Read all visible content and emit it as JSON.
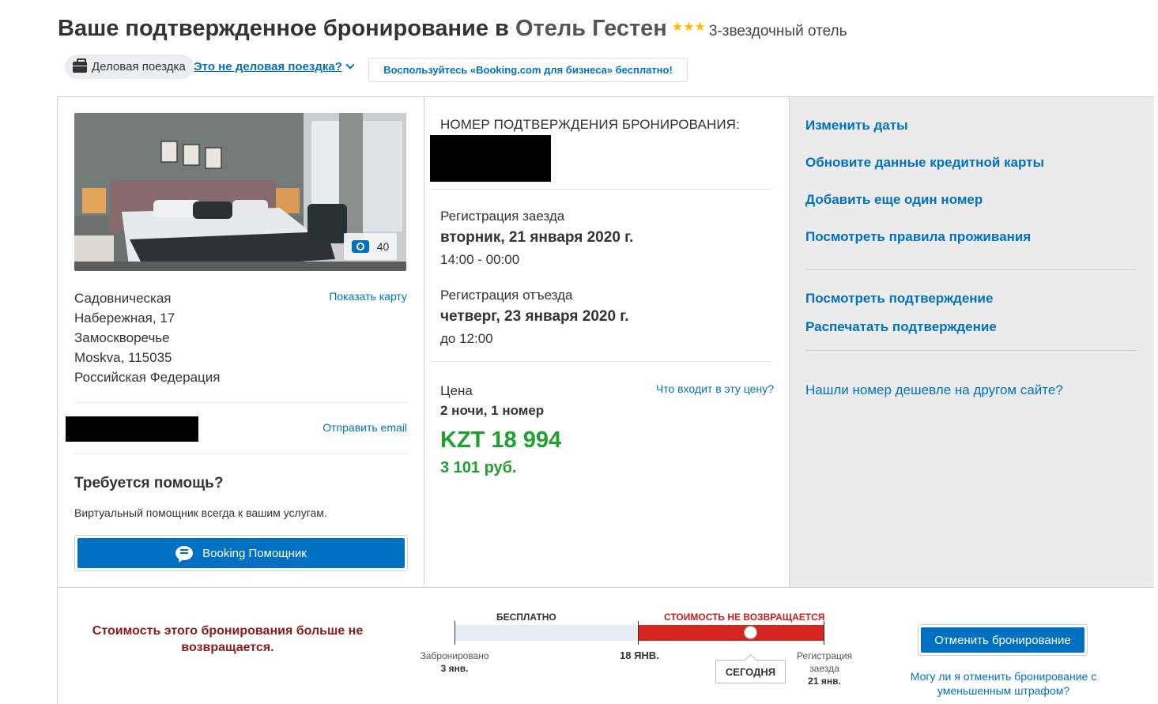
{
  "header": {
    "title_prefix": "Ваше подтвержденное бронирование в ",
    "hotel_name": "Отель Гестен",
    "stars": "★★★",
    "stars_label": "3-звездочный отель"
  },
  "trip": {
    "type_label": "Деловая поездка",
    "not_business_link": "Это не деловая поездка?",
    "business_promo": "Воспользуйтесь «Booking.com для бизнеса» бесплатно!"
  },
  "hotel": {
    "photo_count": "40",
    "address_lines": [
      "Садовническая",
      "Набережная, 17",
      "Замоскворечье",
      "Moskva, 115035",
      "Российская Федерация"
    ],
    "show_map": "Показать карту",
    "send_email": "Отправить email",
    "help_title": "Требуется помощь?",
    "help_subtitle": "Виртуальный помощник всегда к вашим услугам.",
    "assistant_button": "Booking Помощник"
  },
  "booking": {
    "confirmation_label": "НОМЕР ПОДТВЕРЖДЕНИЯ БРОНИРОВАНИЯ:",
    "checkin_label": "Регистрация заезда",
    "checkin_date": "вторник, 21 января 2020 г.",
    "checkin_time": "14:00 - 00:00",
    "checkout_label": "Регистрация отъезда",
    "checkout_date": "четверг, 23 января 2020 г.",
    "checkout_time": "до 12:00",
    "price_label": "Цена",
    "price_included_link": "Что входит в эту цену?",
    "stay_summary": "2 ночи, 1 номер",
    "price_kzt": "KZT 18 994",
    "price_rub": "3 101 руб."
  },
  "actions": {
    "change_dates": "Изменить даты",
    "update_card": "Обновите данные кредитной карты",
    "add_room": "Добавить еще один номер",
    "house_rules": "Посмотреть правила проживания",
    "view_confirmation": "Посмотреть подтверждение",
    "print_confirmation": "Распечатать подтверждение",
    "found_cheaper": "Нашли номер дешевле на другом сайте?"
  },
  "cancellation": {
    "message": "Стоимость этого бронирования больше не возвращается.",
    "free_label": "БЕСПЛАТНО",
    "nonrefundable_label": "СТОИМОСТЬ НЕ ВОЗВРАЩАЕТСЯ",
    "booked_label": "Забронировано",
    "booked_date": "3 янв.",
    "deadline_date": "18 ЯНВ.",
    "today_label": "СЕГОДНЯ",
    "checkin_label_line1": "Регистрация",
    "checkin_label_line2": "заезда",
    "checkin_date": "21 янв.",
    "cancel_button": "Отменить бронирование",
    "penalty_question": "Могу ли я отменить бронирование с уменьшенным штрафом?"
  },
  "colors": {
    "link_blue": "#0071c2",
    "price_green": "#1fa02f",
    "nonrefundable_red": "#d4261f",
    "star_yellow": "#febb02"
  }
}
